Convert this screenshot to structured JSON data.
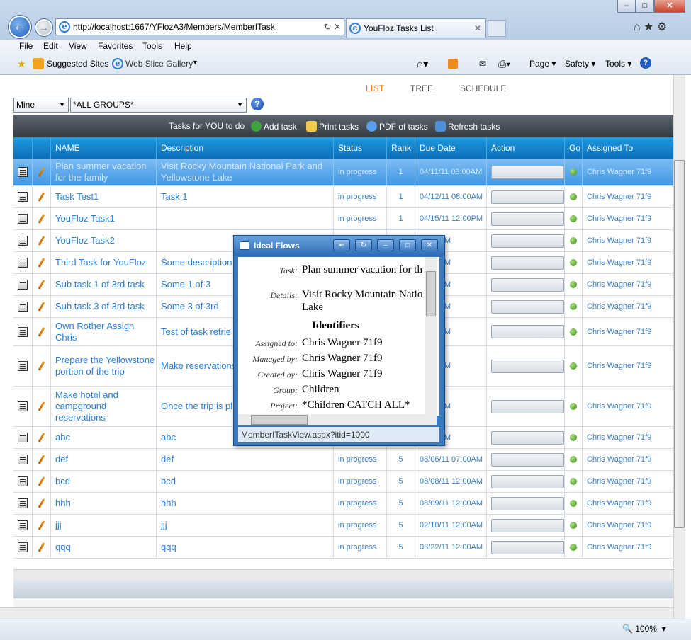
{
  "browser": {
    "url": "http://localhost:1667/YFlozA3/Members/MemberITask:",
    "tab_title": "YouFloz Tasks List",
    "menu": [
      "File",
      "Edit",
      "View",
      "Favorites",
      "Tools",
      "Help"
    ],
    "favorites": {
      "suggested": "Suggested Sites",
      "webslice": "Web Slice Gallery"
    },
    "cmdbar": {
      "page": "Page",
      "safety": "Safety",
      "tools": "Tools"
    },
    "zoom": "100%"
  },
  "view_tabs": [
    "LIST",
    "TREE",
    "SCHEDULE"
  ],
  "filters": {
    "owner": "Mine",
    "group": "*ALL GROUPS*"
  },
  "toolbar": {
    "title": "Tasks for YOU to do",
    "add": "Add task",
    "print": "Print tasks",
    "pdf": "PDF of tasks",
    "refresh": "Refresh tasks"
  },
  "columns": [
    "NAME",
    "Description",
    "Status",
    "Rank",
    "Due Date",
    "Action",
    "Go",
    "Assigned To"
  ],
  "rows": [
    {
      "name": "Plan summer vacation for the family",
      "desc": "Visit Rocky Mountain National Park and Yellowstone Lake",
      "status": "in progress",
      "rank": "1",
      "due": "04/11/11 08:00AM",
      "assigned": "Chris Wagner 71f9"
    },
    {
      "name": "Task Test1",
      "desc": "Task 1",
      "status": "in progress",
      "rank": "1",
      "due": "04/12/11 08:00AM",
      "assigned": "Chris Wagner 71f9"
    },
    {
      "name": "YouFloz Task1",
      "desc": "",
      "status": "in progress",
      "rank": "1",
      "due": "04/15/11 12:00PM",
      "assigned": "Chris Wagner 71f9"
    },
    {
      "name": "YouFloz Task2",
      "desc": "",
      "status": "",
      "rank": "",
      "due": "05:00AM",
      "assigned": "Chris Wagner 71f9"
    },
    {
      "name": "Third Task for YouFloz",
      "desc": "Some description",
      "status": "",
      "rank": "",
      "due": "02:00PM",
      "assigned": "Chris Wagner 71f9"
    },
    {
      "name": "Sub task 1 of 3rd task",
      "desc": "Some 1 of 3",
      "status": "",
      "rank": "",
      "due": "02:00PM",
      "assigned": "Chris Wagner 71f9"
    },
    {
      "name": "Sub task 3 of 3rd task",
      "desc": "Some 3 of 3rd",
      "status": "",
      "rank": "",
      "due": "04:00PM",
      "assigned": "Chris Wagner 71f9"
    },
    {
      "name": "Own Rother Assign Chris",
      "desc": "Test of task retrie",
      "status": "",
      "rank": "",
      "due": "04:00PM",
      "assigned": "Chris Wagner 71f9"
    },
    {
      "name": "Prepare the Yellowstone portion of the trip",
      "desc": "Make reservations, choose dates, etc",
      "status": "",
      "rank": "",
      "due": "12:00AM",
      "assigned": "Chris Wagner 71f9"
    },
    {
      "name": "Make hotel and campground reservations",
      "desc": "Once the trip is pl reservations via th",
      "status": "",
      "rank": "",
      "due": "05:00PM",
      "assigned": "Chris Wagner 71f9"
    },
    {
      "name": "abc",
      "desc": "abc",
      "status": "",
      "rank": "",
      "due": "05:00PM",
      "assigned": "Chris Wagner 71f9"
    },
    {
      "name": "def",
      "desc": "def",
      "status": "in progress",
      "rank": "5",
      "due": "08/06/11 07:00AM",
      "assigned": "Chris Wagner 71f9"
    },
    {
      "name": "bcd",
      "desc": "bcd",
      "status": "in progress",
      "rank": "5",
      "due": "08/08/11 12:00AM",
      "assigned": "Chris Wagner 71f9"
    },
    {
      "name": "hhh",
      "desc": "hhh",
      "status": "in progress",
      "rank": "5",
      "due": "08/09/11 12:00AM",
      "assigned": "Chris Wagner 71f9"
    },
    {
      "name": "jjj",
      "desc": "jjj",
      "status": "in progress",
      "rank": "5",
      "due": "02/10/11 12:00AM",
      "assigned": "Chris Wagner 71f9"
    },
    {
      "name": "qqq",
      "desc": "qqq",
      "status": "in progress",
      "rank": "5",
      "due": "03/22/11 12:00AM",
      "assigned": "Chris Wagner 71f9"
    }
  ],
  "popup": {
    "title": "Ideal Flows",
    "task_label": "Task:",
    "task_value": "Plan summer vacation for th",
    "details_label": "Details:",
    "details_value": "Visit Rocky Mountain Natio",
    "details_value2": "Lake",
    "identifiers": "Identifiers",
    "assigned_label": "Assigned to:",
    "assigned_value": "Chris Wagner 71f9",
    "managed_label": "Managed by:",
    "managed_value": "Chris Wagner 71f9",
    "created_label": "Created by:",
    "created_value": "Chris Wagner 71f9",
    "group_label": "Group:",
    "group_value": "Children",
    "project_label": "Project:",
    "project_value": "*Children CATCH ALL*",
    "status_url": "MemberITaskView.aspx?itid=1000"
  }
}
